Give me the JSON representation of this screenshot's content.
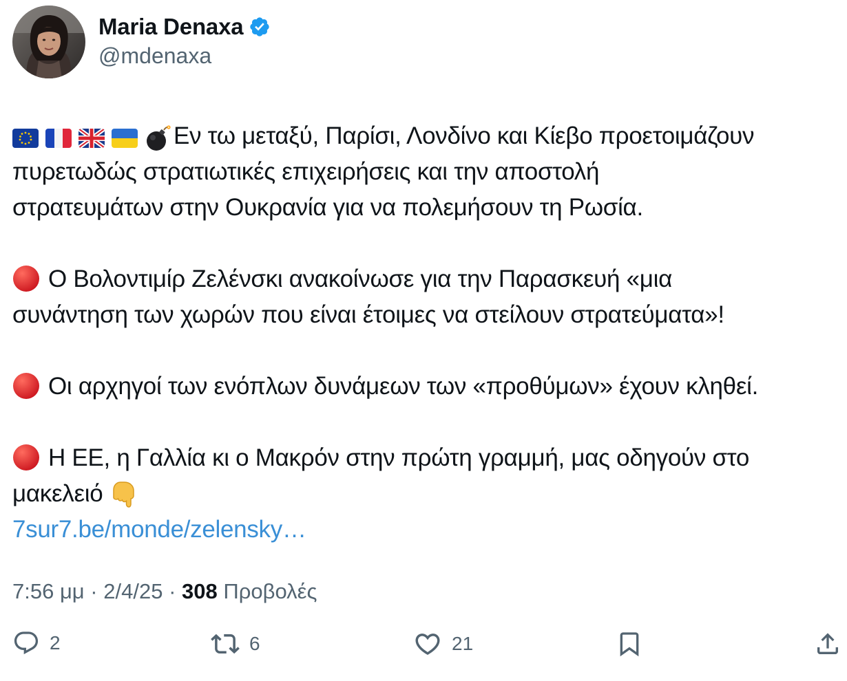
{
  "author": {
    "name": "Maria Denaxa",
    "handle": "@mdenaxa",
    "verified": true,
    "verified_color": "#1d9bf0"
  },
  "tweet": {
    "paragraph1": {
      "emojis": [
        "eu-flag-icon",
        "france-flag-icon",
        "uk-flag-icon",
        "ukraine-flag-icon",
        "bomb-icon"
      ],
      "line1": "Εν τω μεταξύ, Παρίσι, Λονδίνο και Κίεβο προετοιμάζουν",
      "line2": "πυρετωδώς στρατιωτικές επιχειρήσεις και την αποστολή",
      "line3": "στρατευμάτων στην Ουκρανία για να πολεμήσουν τη Ρωσία."
    },
    "paragraph2": {
      "line1": "Ο Βολοντιμίρ Ζελένσκι ανακοίνωσε για την Παρασκευή «μια",
      "line2": "συνάντηση των χωρών που είναι έτοιμες να στείλουν στρατεύματα»!"
    },
    "paragraph3": {
      "line1": "Οι αρχηγοί των ενόπλων δυνάμεων των «προθύμων» έχουν κληθεί."
    },
    "paragraph4": {
      "line1": "Η ΕΕ, η Γαλλία κι ο Μακρόν στην πρώτη γραμμή, μας οδηγούν στο",
      "line2": "μακελειό"
    },
    "link": "7sur7.be/monde/zelensky…",
    "link_color": "#3a8fd6"
  },
  "meta": {
    "time": "7:56 μμ",
    "separator": "·",
    "date": "2/4/25",
    "views_count": "308",
    "views_label": "Προβολές"
  },
  "actions": {
    "replies": "2",
    "reposts": "6",
    "likes": "21",
    "icons": [
      "reply-icon",
      "repost-icon",
      "like-icon",
      "bookmark-icon",
      "share-icon"
    ]
  }
}
